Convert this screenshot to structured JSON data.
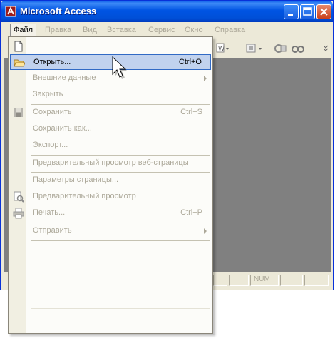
{
  "window": {
    "title": "Microsoft Access"
  },
  "menubar": {
    "items": [
      {
        "label": "Файл"
      },
      {
        "label": "Правка"
      },
      {
        "label": "Вид"
      },
      {
        "label": "Вставка"
      },
      {
        "label": "Сервис"
      },
      {
        "label": "Окно"
      },
      {
        "label": "Справка"
      }
    ]
  },
  "file_menu": {
    "open": {
      "label": "Открыть...",
      "shortcut": "Ctrl+O"
    },
    "external": {
      "label": "Внешние данные"
    },
    "close": {
      "label": "Закрыть"
    },
    "save": {
      "label": "Сохранить",
      "shortcut": "Ctrl+S"
    },
    "save_as": {
      "label": "Сохранить как..."
    },
    "export": {
      "label": "Экспорт..."
    },
    "web_preview": {
      "label": "Предварительный просмотр веб-страницы"
    },
    "page_setup": {
      "label": "Параметры страницы..."
    },
    "preview": {
      "label": "Предварительный просмотр"
    },
    "print": {
      "label": "Печать...",
      "shortcut": "Ctrl+P"
    },
    "send": {
      "label": "Отправить"
    }
  },
  "statusbar": {
    "num": "NUM"
  }
}
